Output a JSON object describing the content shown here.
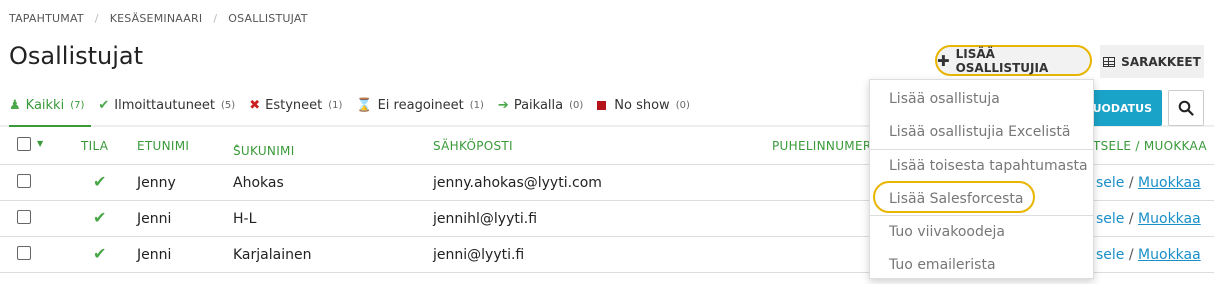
{
  "breadcrumb": [
    "TAPAHTUMAT",
    "KESÄSEMINAARI",
    "OSALLISTUJAT"
  ],
  "page_title": "Osallistujat",
  "toolbar": {
    "add_label": "LISÄÄ OSALLISTUJIA",
    "columns_label": "SARAKKEET",
    "teal_label": "SUODATUS",
    "highlight_color": "#e8b500",
    "accent_color": "#3a9a3a"
  },
  "filters": [
    {
      "label": "Kaikki",
      "count": "(7)",
      "icon": "users-icon"
    },
    {
      "label": "Ilmoittautuneet",
      "count": "(5)",
      "icon": "check-icon"
    },
    {
      "label": "Estyneet",
      "count": "(1)",
      "icon": "x-icon"
    },
    {
      "label": "Ei reagoineet",
      "count": "(1)",
      "icon": "hourglass-icon"
    },
    {
      "label": "Paikalla",
      "count": "(0)",
      "icon": "arrow-right-icon"
    },
    {
      "label": "No show",
      "count": "(0)",
      "icon": "stop-square-icon"
    }
  ],
  "table": {
    "headers": {
      "status": "TILA",
      "firstname": "ETUNIMI",
      "lastname": "SUKUNIMI",
      "email": "SÄHKÖPOSTI",
      "phone": "PUHELINNUMER",
      "actions": "TSELE / MUOKKAA"
    },
    "rows": [
      {
        "firstname": "Jenny",
        "lastname": "Ahokas",
        "email": "jenny.ahokas@lyyti.com",
        "view": "sele",
        "edit": "Muokkaa"
      },
      {
        "firstname": "Jenni",
        "lastname": "H-L",
        "email": "jennihl@lyyti.fi",
        "view": "sele",
        "edit": "Muokkaa"
      },
      {
        "firstname": "Jenni",
        "lastname": "Karjalainen",
        "email": "jenni@lyyti.fi",
        "view": "sele",
        "edit": "Muokkaa"
      }
    ]
  },
  "dropdown": {
    "items": [
      "Lisää osallistuja",
      "Lisää osallistujia Excelistä",
      "Lisää toisesta tapahtumasta",
      "Lisää Salesforcesta",
      "Tuo viivakoodeja",
      "Tuo emailerista"
    ]
  }
}
